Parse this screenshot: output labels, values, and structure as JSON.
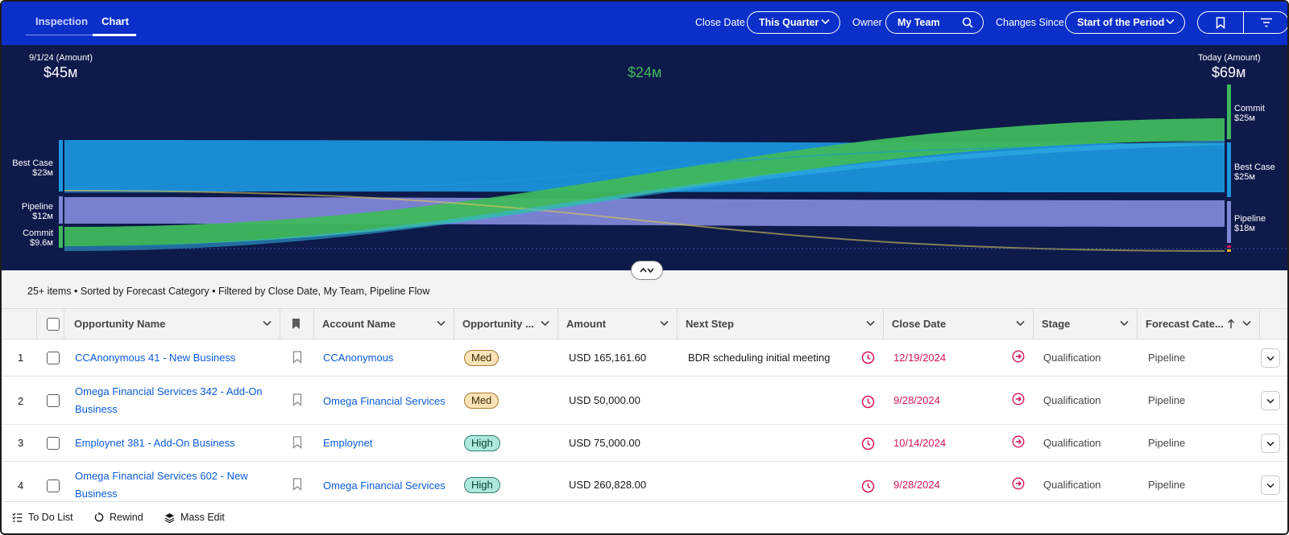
{
  "tabs": [
    {
      "label": "Inspection",
      "active": false
    },
    {
      "label": "Chart",
      "active": true
    }
  ],
  "filters": {
    "close_date": {
      "label": "Close Date",
      "value": "This Quarter"
    },
    "owner": {
      "label": "Owner",
      "value": "My Team"
    },
    "changes_since": {
      "label": "Changes Since",
      "value": "Start of the Period"
    }
  },
  "chart_data": {
    "type": "sankey",
    "left": {
      "caption": "9/1/24 (Amount)",
      "total": "$45м"
    },
    "right": {
      "caption": "Today (Amount)",
      "total": "$69м"
    },
    "change": "$24м",
    "left_nodes": [
      {
        "name": "Best Case",
        "amount": "$23м",
        "value": 23,
        "color": "#1b96e0"
      },
      {
        "name": "Pipeline",
        "amount": "$12м",
        "value": 12,
        "color": "#7f86d6"
      },
      {
        "name": "Commit",
        "amount": "$9.6м",
        "value": 9.6,
        "color": "#3fb85c"
      }
    ],
    "right_nodes": [
      {
        "name": "Commit",
        "amount": "$25м",
        "value": 25,
        "color": "#3fb85c"
      },
      {
        "name": "Best Case",
        "amount": "$25м",
        "value": 25,
        "color": "#1b96e0"
      },
      {
        "name": "Pipeline",
        "amount": "$18м",
        "value": 18,
        "color": "#7f86d6"
      }
    ],
    "flows": [
      {
        "from": "Best Case",
        "to": "Commit"
      },
      {
        "from": "Best Case",
        "to": "Best Case"
      },
      {
        "from": "Pipeline",
        "to": "Pipeline"
      },
      {
        "from": "Commit",
        "to": "Commit"
      }
    ]
  },
  "summary": "25+ items • Sorted by Forecast Category • Filtered by Close Date, My Team, Pipeline Flow",
  "columns": [
    "Opportunity Name",
    "Account Name",
    "Opportunity ...",
    "Amount",
    "Next Step",
    "Close Date",
    "Stage",
    "Forecast Cate..."
  ],
  "rows": [
    {
      "num": "1",
      "name_line1": "CCAnonymous 41 - New Business",
      "name_line2": "",
      "account": "CCAnonymous",
      "score": "Med",
      "amount": "USD 165,161.60",
      "next_step": "BDR scheduling initial meeting",
      "close_date": "12/19/2024",
      "stage": "Qualification",
      "forecast": "Pipeline"
    },
    {
      "num": "2",
      "name_line1": "Omega Financial Services 342 - Add-On",
      "name_line2": "Business",
      "account": "Omega Financial Services",
      "score": "Med",
      "amount": "USD 50,000.00",
      "next_step": "",
      "close_date": "9/28/2024",
      "stage": "Qualification",
      "forecast": "Pipeline"
    },
    {
      "num": "3",
      "name_line1": "Employnet 381 - Add-On Business",
      "name_line2": "",
      "account": "Employnet",
      "score": "High",
      "amount": "USD 75,000.00",
      "next_step": "",
      "close_date": "10/14/2024",
      "stage": "Qualification",
      "forecast": "Pipeline"
    },
    {
      "num": "4",
      "name_line1": "Omega Financial Services 602 - New",
      "name_line2": "Business",
      "account": "Omega Financial Services",
      "score": "High",
      "amount": "USD 260,828.00",
      "next_step": "",
      "close_date": "9/28/2024",
      "stage": "Qualification",
      "forecast": "Pipeline"
    }
  ],
  "footer": {
    "todo": "To Do List",
    "rewind": "Rewind",
    "mass_edit": "Mass Edit"
  },
  "colors": {
    "header": "#0b2fc9",
    "chart_bg": "#0d1a4a",
    "link": "#0b5cd8",
    "date": "#d4145a",
    "change": "#3fb85c"
  }
}
